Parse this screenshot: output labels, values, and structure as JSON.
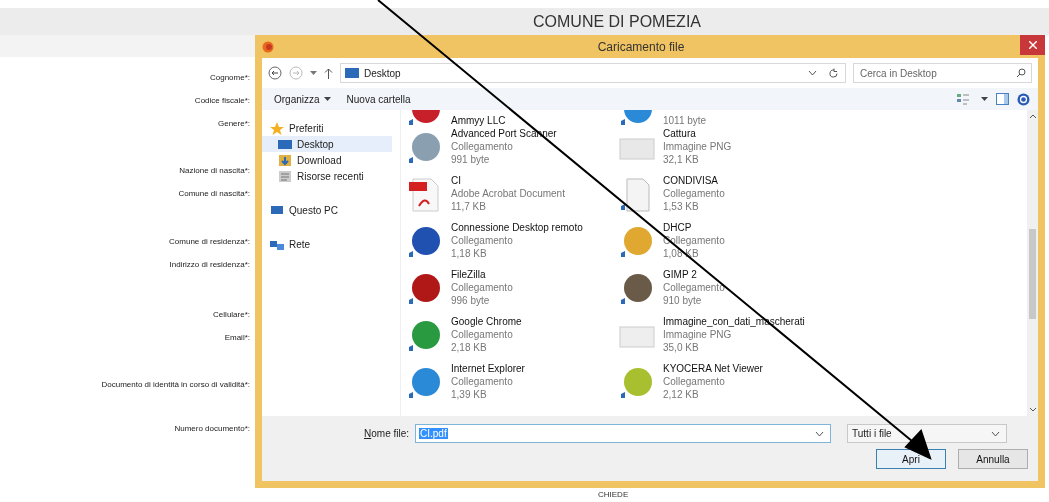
{
  "page": {
    "title": "COMUNE DI POMEZIA",
    "footer": "CHIEDE"
  },
  "form_labels": [
    "Cognome*:",
    "Codice fiscale*:",
    "Genere*:",
    "Nazione di nascita*:",
    "Comune di nascita*:",
    "Comune di residenza*:",
    "Indirizzo di residenza*:",
    "Cellulare*:",
    "Email*:",
    "Documento di identità  in corso di validità*:",
    "Numero documento*:"
  ],
  "dialog": {
    "title": "Caricamento file",
    "address": {
      "path": "Desktop",
      "search_placeholder": "Cerca in Desktop"
    },
    "toolbar": {
      "organize": "Organizza",
      "new_folder": "Nuova cartella"
    },
    "nav": [
      {
        "label": "Preferiti",
        "kind": "star",
        "selected": false,
        "children": [
          {
            "label": "Desktop",
            "kind": "desktop",
            "selected": true
          },
          {
            "label": "Download",
            "kind": "download",
            "selected": false
          },
          {
            "label": "Risorse recenti",
            "kind": "recent",
            "selected": false
          }
        ]
      },
      {
        "label": "Questo PC",
        "kind": "pc",
        "selected": false
      },
      {
        "label": "Rete",
        "kind": "network",
        "selected": false
      }
    ],
    "files": [
      {
        "name": "Ammyy LLC",
        "kind": "app",
        "color": "#c8202a"
      },
      {
        "size": "1011 byte",
        "kind": "app",
        "color": "#2a8ad8"
      },
      {
        "name": "Advanced Port Scanner",
        "type": "Collegamento",
        "size": "991 byte",
        "kind": "app",
        "color": "#8aa0b0"
      },
      {
        "name": "Cattura",
        "type": "Immagine PNG",
        "size": "32,1 KB",
        "kind": "image",
        "color": "#e8e8e8"
      },
      {
        "name": "CI",
        "type": "Adobe Acrobat Document",
        "size": "11,7 KB",
        "kind": "pdf",
        "color": "#d42020"
      },
      {
        "name": "CONDIVISA",
        "type": "Collegamento",
        "size": "1,53 KB",
        "kind": "doc",
        "color": "#f4f4f4"
      },
      {
        "name": "Connessione Desktop remoto",
        "type": "Collegamento",
        "size": "1,18 KB",
        "kind": "app",
        "color": "#2050b0"
      },
      {
        "name": "DHCP",
        "type": "Collegamento",
        "size": "1,08 KB",
        "kind": "app",
        "color": "#e0a830"
      },
      {
        "name": "FileZilla",
        "type": "Collegamento",
        "size": "996 byte",
        "kind": "app",
        "color": "#b01818"
      },
      {
        "name": "GIMP 2",
        "type": "Collegamento",
        "size": "910 byte",
        "kind": "app",
        "color": "#6a5a48"
      },
      {
        "name": "Google Chrome",
        "type": "Collegamento",
        "size": "2,18 KB",
        "kind": "app",
        "color": "#2a9a40"
      },
      {
        "name": "Immagine_con_dati_mascherati",
        "type": "Immagine PNG",
        "size": "35,0 KB",
        "kind": "image",
        "color": "#eeeeee"
      },
      {
        "name": "Internet Explorer",
        "type": "Collegamento",
        "size": "1,39 KB",
        "kind": "app",
        "color": "#2a8ad8"
      },
      {
        "name": "KYOCERA Net Viewer",
        "type": "Collegamento",
        "size": "2,12 KB",
        "kind": "app",
        "color": "#a8c030"
      }
    ],
    "filename": {
      "label": "Nome file:",
      "value": "CI.pdf"
    },
    "filter": "Tutti i file",
    "buttons": [
      "Apri",
      "Annulla"
    ]
  }
}
